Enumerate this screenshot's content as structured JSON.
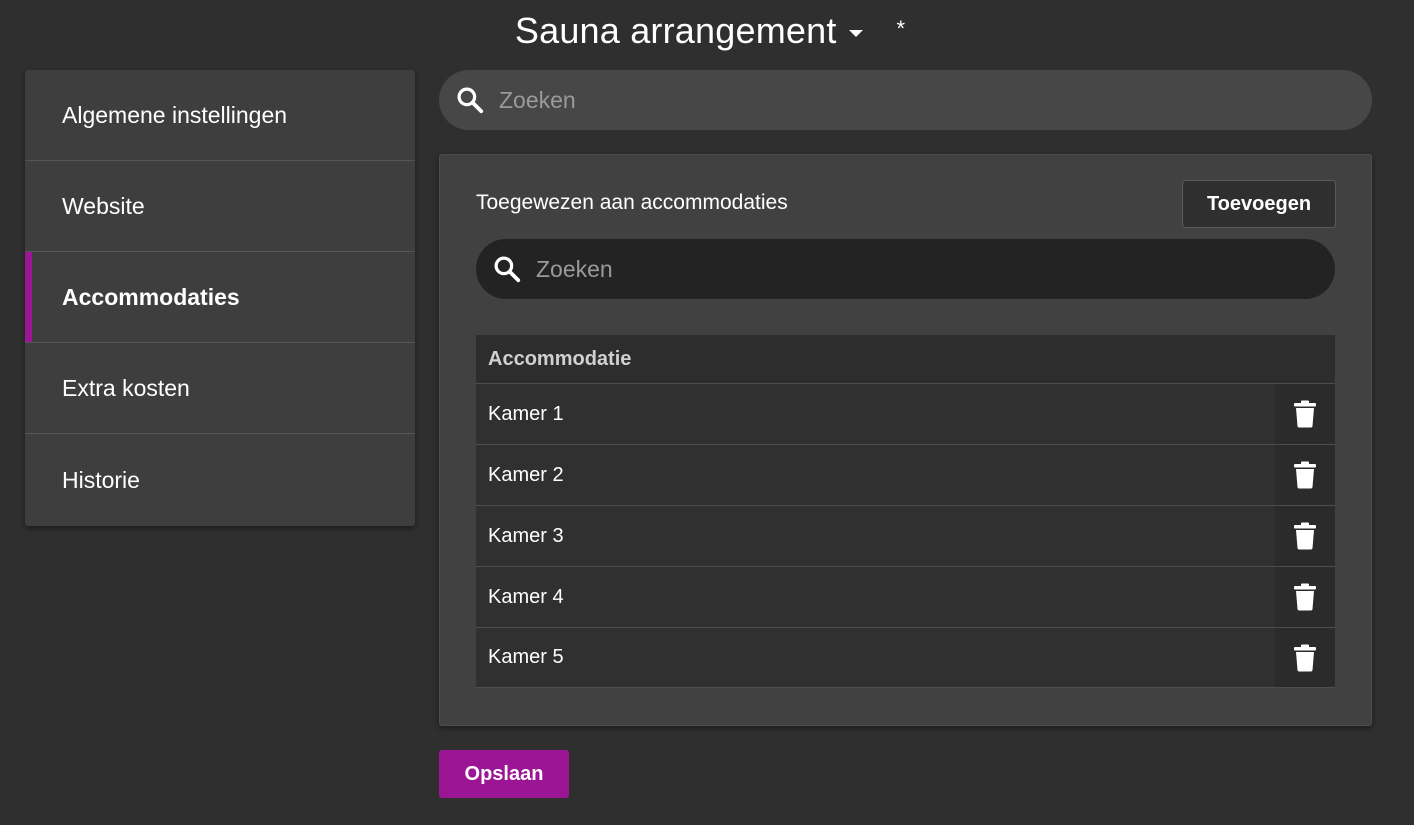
{
  "header": {
    "title": "Sauna arrangement",
    "dropdown_icon": "caret-down-icon",
    "modified_marker": "*"
  },
  "sidebar": {
    "items": [
      {
        "label": "Algemene instellingen",
        "active": false
      },
      {
        "label": "Website",
        "active": false
      },
      {
        "label": "Accommodaties",
        "active": true
      },
      {
        "label": "Extra kosten",
        "active": false
      },
      {
        "label": "Historie",
        "active": false
      }
    ]
  },
  "search": {
    "placeholder": "Zoeken",
    "icon": "search-icon"
  },
  "card": {
    "title": "Toegewezen aan accommodaties",
    "add_label": "Toevoegen",
    "search_placeholder": "Zoeken",
    "table": {
      "header": "Accommodatie",
      "rows": [
        {
          "name": "Kamer 1"
        },
        {
          "name": "Kamer 2"
        },
        {
          "name": "Kamer 3"
        },
        {
          "name": "Kamer 4"
        },
        {
          "name": "Kamer 5"
        }
      ],
      "row_action_icon": "trash-icon"
    }
  },
  "footer": {
    "save_label": "Opslaan"
  },
  "colors": {
    "background": "#2f2f2f",
    "accent": "#9b1595",
    "panel": "#3e3e3e"
  }
}
